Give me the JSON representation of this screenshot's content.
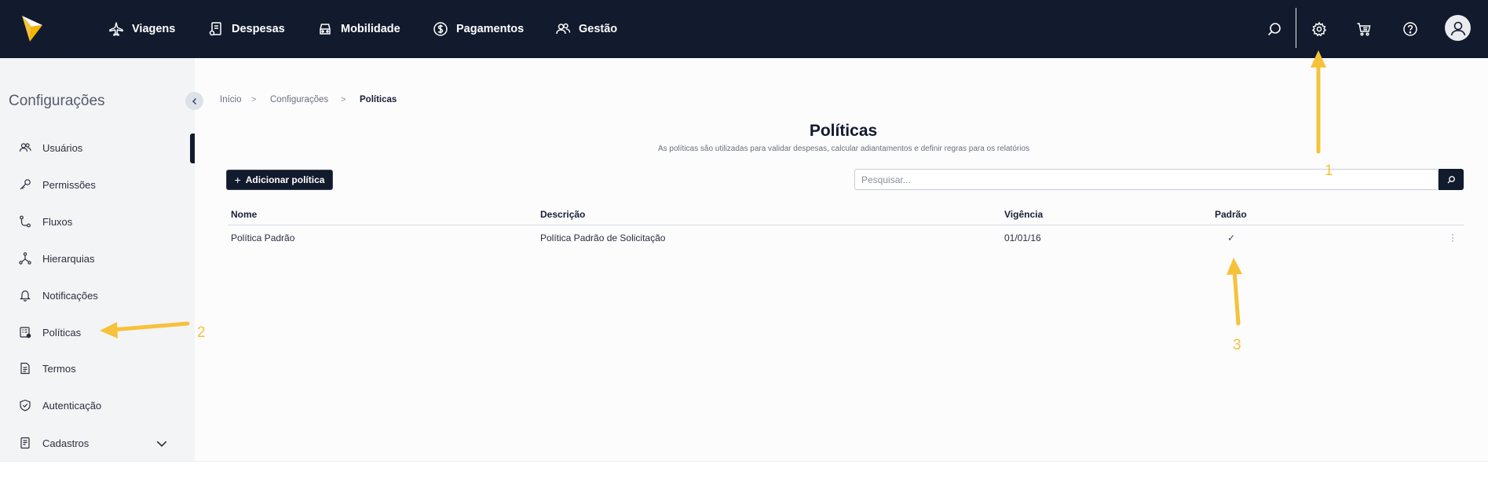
{
  "topnav": {
    "items": [
      {
        "label": "Viagens",
        "icon": "airplane-icon"
      },
      {
        "label": "Despesas",
        "icon": "receipt-icon"
      },
      {
        "label": "Mobilidade",
        "icon": "car-icon"
      },
      {
        "label": "Pagamentos",
        "icon": "dollar-icon"
      },
      {
        "label": "Gestão",
        "icon": "users-icon"
      }
    ],
    "icons": [
      "search-icon",
      "gear-icon",
      "cart-icon",
      "help-icon",
      "avatar-icon"
    ]
  },
  "sidebar": {
    "title": "Configurações",
    "items": [
      {
        "label": "Usuários",
        "icon": "users-icon"
      },
      {
        "label": "Permissões",
        "icon": "key-icon"
      },
      {
        "label": "Fluxos",
        "icon": "flow-icon"
      },
      {
        "label": "Hierarquias",
        "icon": "hierarchy-icon"
      },
      {
        "label": "Notificações",
        "icon": "bell-icon"
      },
      {
        "label": "Políticas",
        "icon": "policy-icon"
      },
      {
        "label": "Termos",
        "icon": "document-icon"
      },
      {
        "label": "Autenticação",
        "icon": "shield-icon"
      },
      {
        "label": "Cadastros",
        "icon": "register-icon"
      }
    ]
  },
  "breadcrumb": {
    "items": [
      "Início",
      "Configurações",
      "Políticas"
    ],
    "separator": ">"
  },
  "page": {
    "title": "Políticas",
    "subtitle": "As políticas são utilizadas para validar despesas, calcular adiantamentos e definir regras para os relatórios",
    "add_button": "Adicionar política",
    "add_icon": "+",
    "search_placeholder": "Pesquisar..."
  },
  "table": {
    "columns": [
      "Nome",
      "Descrição",
      "Vigência",
      "Padrão"
    ],
    "rows": [
      {
        "nome": "Política Padrão",
        "descricao": "Política Padrão de Solicitação",
        "vigencia": "01/01/16",
        "padrao": "✓"
      }
    ]
  },
  "annotations": {
    "labels": [
      "1",
      "2",
      "3"
    ],
    "color": "#f6c23a"
  },
  "colors": {
    "navy": "#121a2d",
    "sidebar_bg": "#f3f4f6",
    "accent_yellow": "#f6c23a"
  }
}
